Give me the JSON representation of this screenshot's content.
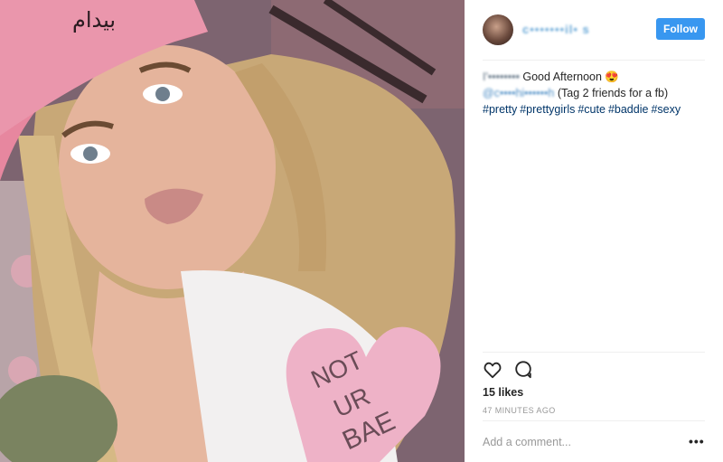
{
  "post": {
    "image_alt": "",
    "shirt_text": [
      "NOT",
      "UR",
      "BAE"
    ]
  },
  "header": {
    "username": "c•••••••il• s",
    "follow_label": "Follow"
  },
  "caption": {
    "prefix_blurred": "I'••••••••",
    "text": "Good Afternoon",
    "emoji": "😍",
    "mention_blurred": "@c••••hi••••••h",
    "mention_note": "(Tag 2 friends for a fb)",
    "hashtags": [
      "#pretty",
      "#prettygirls",
      "#cute",
      "#baddie",
      "#sexy"
    ]
  },
  "actions": {
    "like_icon": "heart-icon",
    "comment_icon": "comment-bubble-icon"
  },
  "likes_text": "15 likes",
  "timestamp": "47 MINUTES AGO",
  "comment": {
    "placeholder": "Add a comment...",
    "more_label": "•••"
  }
}
